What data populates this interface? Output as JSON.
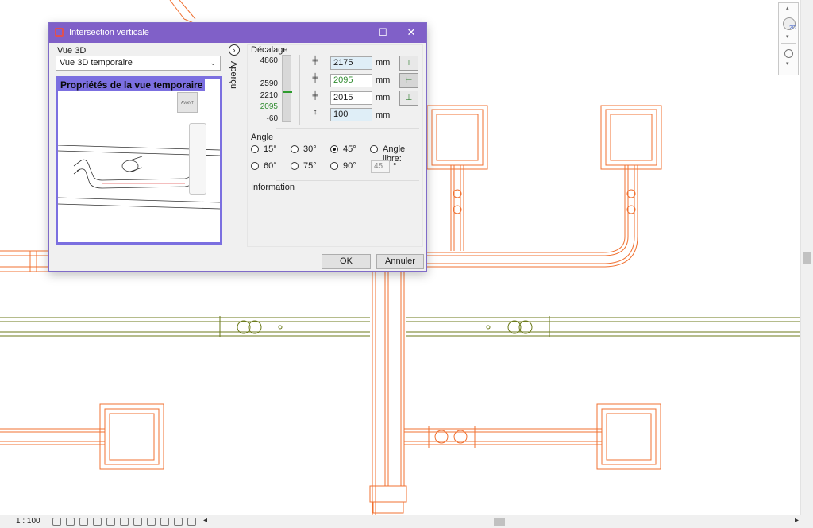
{
  "dialog": {
    "title": "Intersection verticale",
    "close": "✕",
    "maximize": "☐",
    "minimize": "—"
  },
  "view3d": {
    "label": "Vue 3D",
    "selected": "Vue 3D temporaire",
    "preview_title": "Propriétés de la vue temporaire",
    "cube_label": "AVANT"
  },
  "apercu": {
    "label": "Aperçu",
    "button": "›"
  },
  "decalage": {
    "label": "Décalage",
    "ruler_labels": [
      "4860",
      "2590",
      "2210",
      "2095",
      "-60"
    ],
    "rows": [
      {
        "value": "2175",
        "unit": "mm",
        "state": "highlighted"
      },
      {
        "value": "2095",
        "unit": "mm",
        "state": "green"
      },
      {
        "value": "2015",
        "unit": "mm",
        "state": "normal"
      },
      {
        "value": "100",
        "unit": "mm",
        "state": "highlighted"
      }
    ]
  },
  "angle": {
    "label": "Angle",
    "options": [
      "15°",
      "30°",
      "45°",
      "Angle libre:",
      "60°",
      "75°",
      "90°"
    ],
    "selected": "45°",
    "free_value": "45",
    "free_unit": "°"
  },
  "information": {
    "label": "Information"
  },
  "buttons": {
    "ok": "OK",
    "cancel": "Annuler"
  },
  "statusbar": {
    "scale": "1 : 100"
  },
  "nav": {
    "mode": "2D"
  },
  "colors": {
    "titlebar": "#8060c8",
    "duct": "#f07030",
    "pipe": "#6b7a1a",
    "ruler_mark": "#2e9c2e"
  }
}
